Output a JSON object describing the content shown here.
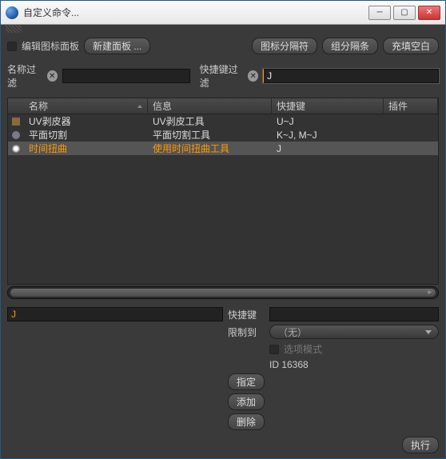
{
  "window": {
    "title": "自定义命令..."
  },
  "toolbar": {
    "edit_icons_label": "编辑图标面板",
    "new_panel_label": "新建面板 ...",
    "btn_icon_sep": "图标分隔符",
    "btn_group_sep": "组分隔条",
    "btn_fill_blank": "充填空白"
  },
  "filters": {
    "name_label": "名称过滤",
    "name_value": "",
    "shortcut_label": "快捷键过滤",
    "shortcut_value": "J"
  },
  "columns": {
    "name": "名称",
    "info": "信息",
    "key": "快捷键",
    "plugin": "插件"
  },
  "rows": [
    {
      "name": "UV剥皮器",
      "info": "UV剥皮工具",
      "key": "U~J",
      "selected": false,
      "icon": "a"
    },
    {
      "name": "平面切割",
      "info": "平面切割工具",
      "key": "K~J, M~J",
      "selected": false,
      "icon": "b"
    },
    {
      "name": "时间扭曲",
      "info": "使用时间扭曲工具",
      "key": "J",
      "selected": true,
      "icon": "c"
    }
  ],
  "status": {
    "text": "J"
  },
  "form": {
    "shortcut_label": "快捷键",
    "shortcut_value": "",
    "restrict_label": "限制到",
    "restrict_value": "（无）",
    "option_mode_label": "选项模式",
    "id_label": "ID 16368"
  },
  "actions": {
    "assign": "指定",
    "add": "添加",
    "delete": "删除",
    "execute": "执行"
  }
}
